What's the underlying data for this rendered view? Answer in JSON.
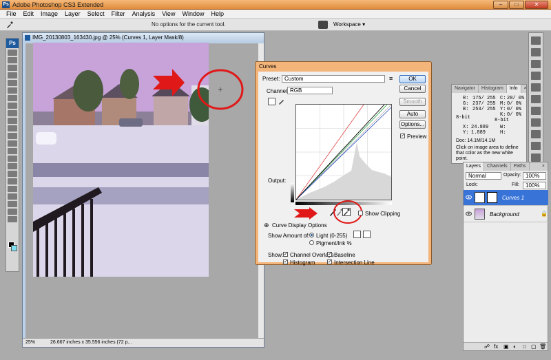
{
  "app": {
    "title": "Adobe Photoshop CS3 Extended",
    "window_buttons": [
      "–",
      "□",
      "✕"
    ],
    "menus": [
      "File",
      "Edit",
      "Image",
      "Layer",
      "Select",
      "Filter",
      "Analysis",
      "View",
      "Window",
      "Help"
    ],
    "options_hint": "No options for the current tool.",
    "workspace_label": "Workspace ▾"
  },
  "document": {
    "title": "IMG_20130803_163430.jpg @ 25% (Curves 1, Layer Mask/8)",
    "zoom": "25%",
    "doc_info": "26.667 inches x 35.556 inches (72 p..."
  },
  "curves": {
    "title": "Curves",
    "preset_label": "Preset:",
    "preset_value": "Custom",
    "channel_label": "Channel:",
    "channel_value": "RGB",
    "output_label": "Output:",
    "ok": "OK",
    "cancel": "Cancel",
    "smooth": "Smooth",
    "auto": "Auto",
    "options": "Options...",
    "preview": "Preview",
    "show_clipping": "Show Clipping",
    "display_options": "Curve Display Options",
    "show_amount_label": "Show Amount of:",
    "light_label": "Light (0-255)",
    "pigment_label": "Pigment/Ink %",
    "show_label": "Show:",
    "channel_overlays": "Channel Overlays",
    "baseline": "Baseline",
    "histogram": "Histogram",
    "intersection_line": "Intersection Line"
  },
  "info_panel": {
    "tabs": [
      "Navigator",
      "Histogram",
      "Info"
    ],
    "close_glyph": "×",
    "r": "R:",
    "r_val": "175/ 255",
    "g": "G:",
    "g_val": "237/ 255",
    "b": "B:",
    "b_val": "253/ 255",
    "c": "C:",
    "c_val": "28/ 0%",
    "m": "M:",
    "m_val": "0/ 0%",
    "y": "Y:",
    "y_val": "0/ 0%",
    "k": "K:",
    "k_val": "0/ 0%",
    "bit_left": "8-bit",
    "bit_right": "8-bit",
    "x": "X:",
    "x_val": "24.889",
    "yy": "Y:",
    "yy_val": "1.889",
    "w": "W:",
    "h": "H:",
    "doc": "Doc: 14.1M/14.1M",
    "hint": "Click on image area to define that color as the new white point."
  },
  "layers_panel": {
    "tabs": [
      "Layers",
      "Channels",
      "Paths"
    ],
    "close_glyph": "×",
    "blend_mode": "Normal",
    "opacity_label": "Opacity:",
    "opacity_value": "100%",
    "lock_label": "Lock:",
    "fill_label": "Fill:",
    "fill_value": "100%",
    "layers": [
      {
        "name": "Curves 1",
        "selected": true
      },
      {
        "name": "Background",
        "selected": false
      }
    ]
  },
  "colors": {
    "accent_orange": "#f07e2a",
    "selection_blue": "#3874d8",
    "annotation_red": "#e01818"
  }
}
